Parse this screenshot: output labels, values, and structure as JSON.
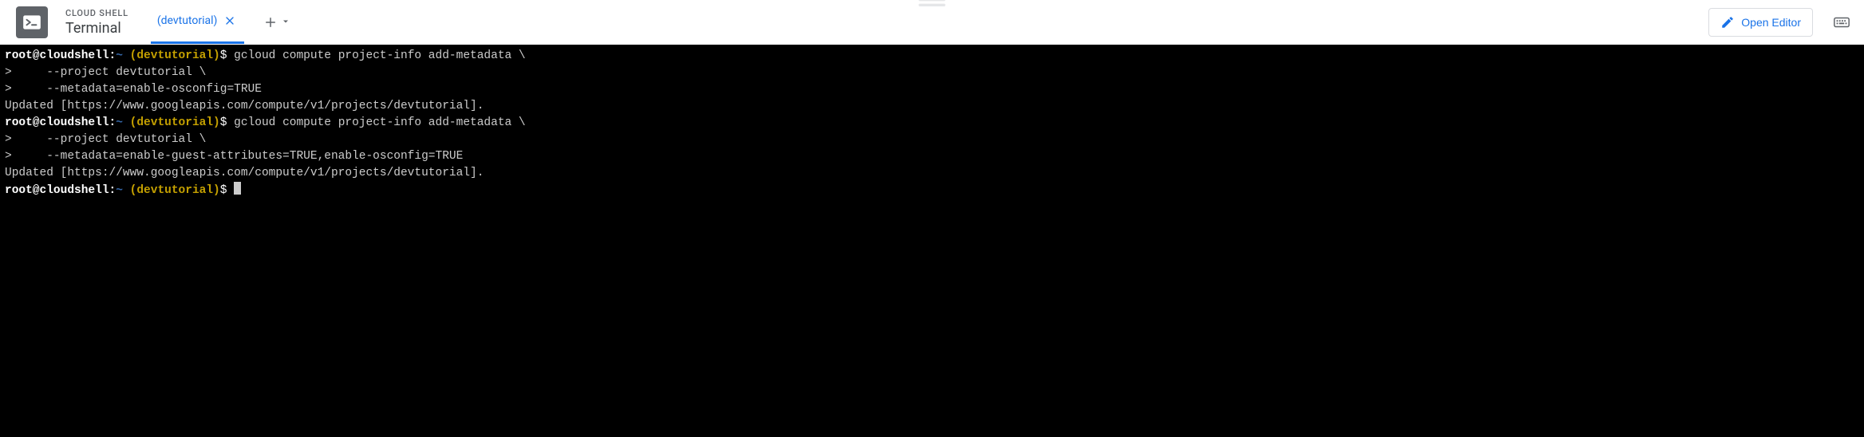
{
  "header": {
    "overline": "CLOUD SHELL",
    "title": "Terminal",
    "activeTab": "(devtutorial)",
    "openEditor": "Open Editor"
  },
  "terminal": {
    "lines": [
      {
        "type": "prompt_cmd",
        "user": "root",
        "host": "cloudshell",
        "path": "~",
        "project": "(devtutorial)",
        "cmd": "gcloud compute project-info add-metadata \\"
      },
      {
        "type": "cont",
        "text": ">     --project devtutorial \\"
      },
      {
        "type": "cont",
        "text": ">     --metadata=enable-osconfig=TRUE"
      },
      {
        "type": "out",
        "text": "Updated [https://www.googleapis.com/compute/v1/projects/devtutorial]."
      },
      {
        "type": "prompt_cmd",
        "user": "root",
        "host": "cloudshell",
        "path": "~",
        "project": "(devtutorial)",
        "cmd": "gcloud compute project-info add-metadata \\"
      },
      {
        "type": "cont",
        "text": ">     --project devtutorial \\"
      },
      {
        "type": "cont",
        "text": ">     --metadata=enable-guest-attributes=TRUE,enable-osconfig=TRUE"
      },
      {
        "type": "out",
        "text": "Updated [https://www.googleapis.com/compute/v1/projects/devtutorial]."
      },
      {
        "type": "prompt_cursor",
        "user": "root",
        "host": "cloudshell",
        "path": "~",
        "project": "(devtutorial)"
      }
    ]
  }
}
